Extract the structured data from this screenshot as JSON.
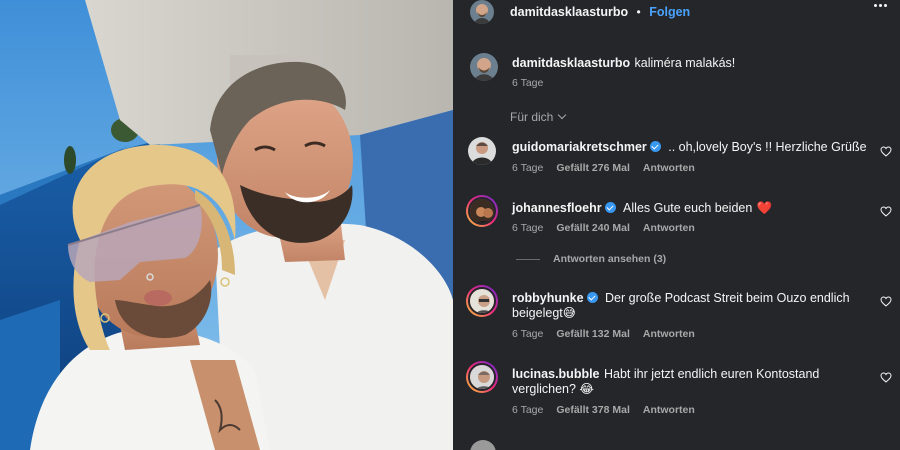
{
  "post": {
    "author": "damitdasklaasturbo",
    "follow_label": "Folgen",
    "caption_user": "damitdasklaasturbo",
    "caption_text": "kaliméra malakás!",
    "caption_time": "6 Tage"
  },
  "sort": {
    "label": "Für dich"
  },
  "comments": [
    {
      "user": "guidomariakretschmer",
      "verified": true,
      "text": ".. oh,lovely Boy's !! Herzliche Grüße",
      "time": "6 Tage",
      "likes": "Gefällt 276 Mal",
      "reply": "Antworten"
    },
    {
      "user": "johannesfloehr",
      "verified": true,
      "text": "Alles Gute euch beiden",
      "emoji": "❤️",
      "time": "6 Tage",
      "likes": "Gefällt 240 Mal",
      "reply": "Antworten",
      "view_replies": "Antworten ansehen (3)"
    },
    {
      "user": "robbyhunke",
      "verified": true,
      "text_line1": "Der große Podcast Streit beim Ouzo endlich",
      "text_line2": "beigelegt",
      "emoji": "😅",
      "time": "6 Tage",
      "likes": "Gefällt 132 Mal",
      "reply": "Antworten"
    },
    {
      "user": "lucinas.bubble",
      "verified": false,
      "text_line1": "Habt ihr jetzt endlich euren Kontostand",
      "text_line2": "verglichen?",
      "emoji": "😂",
      "time": "6 Tage",
      "likes": "Gefällt 378 Mal",
      "reply": "Antworten"
    }
  ],
  "icons": [
    "more-icon",
    "heart-icon",
    "verified-badge-icon",
    "chevron-down-icon"
  ],
  "colors": {
    "panel": "#24262a",
    "link": "#4aa3ff",
    "muted": "#a8a8a8",
    "verified": "#3897f0"
  }
}
